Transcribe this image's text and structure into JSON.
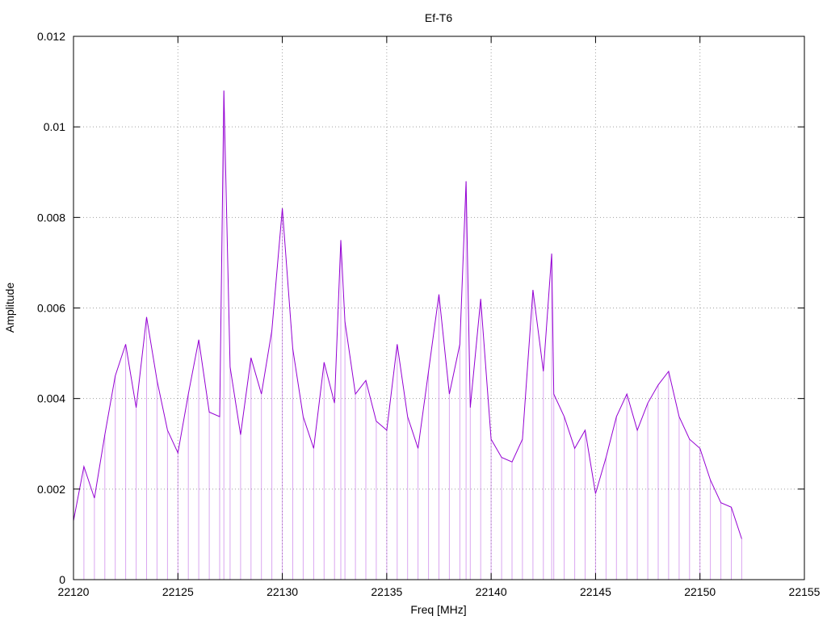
{
  "chart_data": {
    "type": "line",
    "title": "Ef-T6",
    "xlabel": "Freq [MHz]",
    "ylabel": "Amplitude",
    "xlim": [
      22120,
      22155
    ],
    "ylim": [
      0,
      0.012
    ],
    "x_ticks": [
      "22120",
      "22125",
      "22130",
      "22135",
      "22140",
      "22145",
      "22150",
      "22155"
    ],
    "y_ticks": [
      "0",
      "0.002",
      "0.004",
      "0.006",
      "0.008",
      "0.01",
      "0.012"
    ],
    "grid": true,
    "grid_style": "dotted",
    "line_color": "#9400d3",
    "series": [
      {
        "name": "",
        "x": [
          22120.0,
          22120.5,
          22121.0,
          22121.5,
          22122.0,
          22122.5,
          22123.0,
          22123.5,
          22124.0,
          22124.5,
          22125.0,
          22125.5,
          22126.0,
          22126.5,
          22127.0,
          22127.2,
          22127.5,
          22128.0,
          22128.5,
          22129.0,
          22129.5,
          22130.0,
          22130.5,
          22131.0,
          22131.5,
          22132.0,
          22132.5,
          22132.8,
          22133.0,
          22133.5,
          22134.0,
          22134.5,
          22135.0,
          22135.5,
          22136.0,
          22136.5,
          22137.0,
          22137.5,
          22138.0,
          22138.5,
          22138.8,
          22139.0,
          22139.5,
          22140.0,
          22140.5,
          22141.0,
          22141.5,
          22142.0,
          22142.5,
          22142.9,
          22143.0,
          22143.5,
          22144.0,
          22144.5,
          22145.0,
          22145.5,
          22146.0,
          22146.5,
          22147.0,
          22147.5,
          22148.0,
          22148.5,
          22149.0,
          22149.5,
          22150.0,
          22150.5,
          22151.0,
          22151.5,
          22152.0
        ],
        "y": [
          0.0013,
          0.0025,
          0.0018,
          0.0032,
          0.0045,
          0.0052,
          0.0038,
          0.0058,
          0.0044,
          0.0033,
          0.0028,
          0.0041,
          0.0053,
          0.0037,
          0.0036,
          0.0108,
          0.0047,
          0.0032,
          0.0049,
          0.0041,
          0.0055,
          0.0082,
          0.0051,
          0.0036,
          0.0029,
          0.0048,
          0.0039,
          0.0075,
          0.0057,
          0.0041,
          0.0044,
          0.0035,
          0.0033,
          0.0052,
          0.0036,
          0.0029,
          0.0046,
          0.0063,
          0.0041,
          0.0052,
          0.0088,
          0.0038,
          0.0062,
          0.0031,
          0.0027,
          0.0026,
          0.0031,
          0.0064,
          0.0046,
          0.0072,
          0.0041,
          0.0036,
          0.0029,
          0.0033,
          0.0019,
          0.0027,
          0.0036,
          0.0041,
          0.0033,
          0.0039,
          0.0043,
          0.0046,
          0.0036,
          0.0031,
          0.0029,
          0.0022,
          0.0017,
          0.0016,
          0.0009
        ]
      }
    ]
  }
}
